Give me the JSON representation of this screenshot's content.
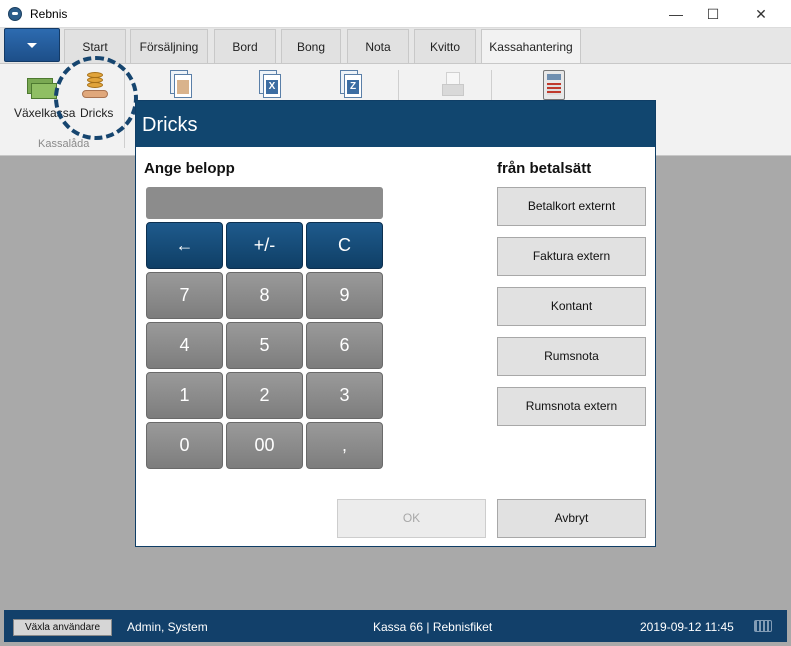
{
  "window": {
    "title": "Rebnis",
    "min_icon": "—",
    "max_icon": "☐",
    "close_icon": "✕"
  },
  "ribbon": {
    "tabs": [
      {
        "label": "Start"
      },
      {
        "label": "Försäljning"
      },
      {
        "label": "Bord"
      },
      {
        "label": "Bong"
      },
      {
        "label": "Nota"
      },
      {
        "label": "Kvitto"
      },
      {
        "label": "Kassahantering"
      }
    ],
    "active_tab": "Kassahantering",
    "buttons": {
      "vaxelkassa_label": "Växelkassa",
      "dricks_label": "Dricks"
    },
    "group_label": "Kassalåda"
  },
  "dialog": {
    "title": "Dricks",
    "amount_label": "Ange belopp",
    "amount_value": "",
    "method_label": "från betalsätt",
    "keypad": {
      "backspace": "←",
      "plusminus": "+/-",
      "clear": "C",
      "k7": "7",
      "k8": "8",
      "k9": "9",
      "k4": "4",
      "k5": "5",
      "k6": "6",
      "k1": "1",
      "k2": "2",
      "k3": "3",
      "k0": "0",
      "k00": "00",
      "comma": ","
    },
    "payment_methods": {
      "m1": "Betalkort externt",
      "m2": "Faktura extern",
      "m3": "Kontant",
      "m4": "Rumsnota",
      "m5": "Rumsnota extern"
    },
    "ok_label": "OK",
    "cancel_label": "Avbryt"
  },
  "statusbar": {
    "switch_user_label": "Växla användare",
    "user": "Admin, System",
    "register": "Kassa 66 | Rebnisfiket",
    "datetime": "2019-09-12 11:45"
  },
  "colors": {
    "accent": "#11466f",
    "status_bar": "#12406a",
    "keypad_gray": "#8c8c8c",
    "keypad_blue": "#15507e"
  }
}
